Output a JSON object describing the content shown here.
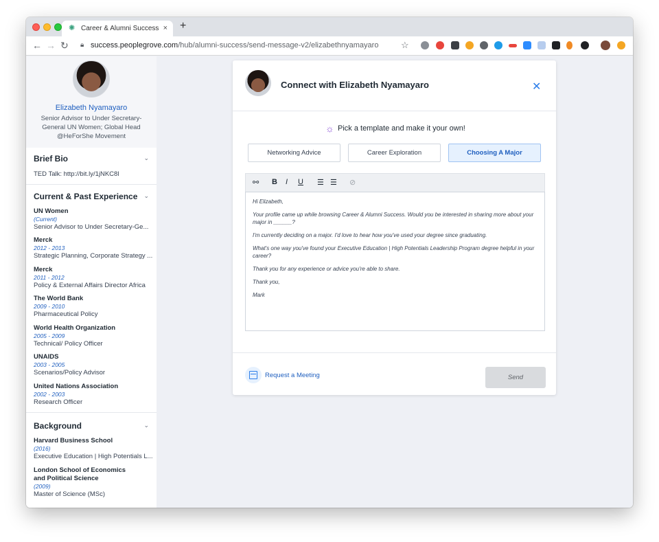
{
  "browser": {
    "tab_title": "Career & Alumni Success",
    "tab_close": "×",
    "new_tab": "+",
    "url_host": "success.peoplegrove.com",
    "url_path": "/hub/alumni-success/send-message-v2/elizabethnyamayaro",
    "nav_back": "←",
    "nav_forward": "→",
    "nav_reload": "↻",
    "star": "☆"
  },
  "profile": {
    "name": "Elizabeth Nyamayaro",
    "title_lines": [
      "Senior Advisor to Under Secretary-",
      "General UN Women; Global Head",
      "@HeForShe Movement"
    ]
  },
  "sidebar": {
    "brief_bio": {
      "heading": "Brief Bio",
      "text": "TED Talk: http://bit.ly/1jNKC8l"
    },
    "experience": {
      "heading": "Current & Past Experience",
      "items": [
        {
          "org": "UN Women",
          "dates": "(Current)",
          "role": "Senior Advisor to Under Secretary-Ge..."
        },
        {
          "org": "Merck",
          "dates": "2012 - 2013",
          "role": "Strategic Planning, Corporate Strategy ..."
        },
        {
          "org": "Merck",
          "dates": "2011 - 2012",
          "role": "Policy & External Affairs Director Africa"
        },
        {
          "org": "The World Bank",
          "dates": "2009 - 2010",
          "role": "Pharmaceutical Policy"
        },
        {
          "org": "World Health Organization",
          "dates": "2005 - 2009",
          "role": "Technical/ Policy Officer"
        },
        {
          "org": "UNAIDS",
          "dates": "2003 - 2005",
          "role": "Scenarios/Policy Advisor"
        },
        {
          "org": "United Nations Association",
          "dates": "2002 - 2003",
          "role": "Research Officer"
        }
      ]
    },
    "background": {
      "heading": "Background",
      "items": [
        {
          "org": "Harvard Business School",
          "dates": "(2016)",
          "role": "Executive Education | High Potentials L..."
        },
        {
          "org": "London School of Economics and Political Science",
          "dates": "(2009)",
          "role": "Master of Science (MSc)"
        }
      ]
    },
    "chevron": "⌄"
  },
  "modal": {
    "title": "Connect with Elizabeth Nyamayaro",
    "close": "✕",
    "prompt": "Pick a template and make it your own!",
    "templates": [
      {
        "label": "Networking Advice",
        "active": false
      },
      {
        "label": "Career Exploration",
        "active": false
      },
      {
        "label": "Choosing A Major",
        "active": true
      }
    ],
    "toolbar": {
      "bold": "B",
      "italic": "I",
      "underline": "U",
      "ordered_list": "☰",
      "bullet_list": "☰"
    },
    "message": [
      "Hi Elizabeth,",
      "Your profile came up while browsing Career & Alumni Success. Would you be interested in sharing more about your major in ______?",
      "I'm currently deciding on a major. I'd love to hear how you've used your degree since graduating.",
      "What's one way you've found your Executive Education | High Potentials Leadership Program degree helpful in your career?",
      "Thank you for any experience or advice you're able to share.",
      "Thank you,",
      "Mark"
    ],
    "request_meeting": "Request a Meeting",
    "send": "Send"
  }
}
